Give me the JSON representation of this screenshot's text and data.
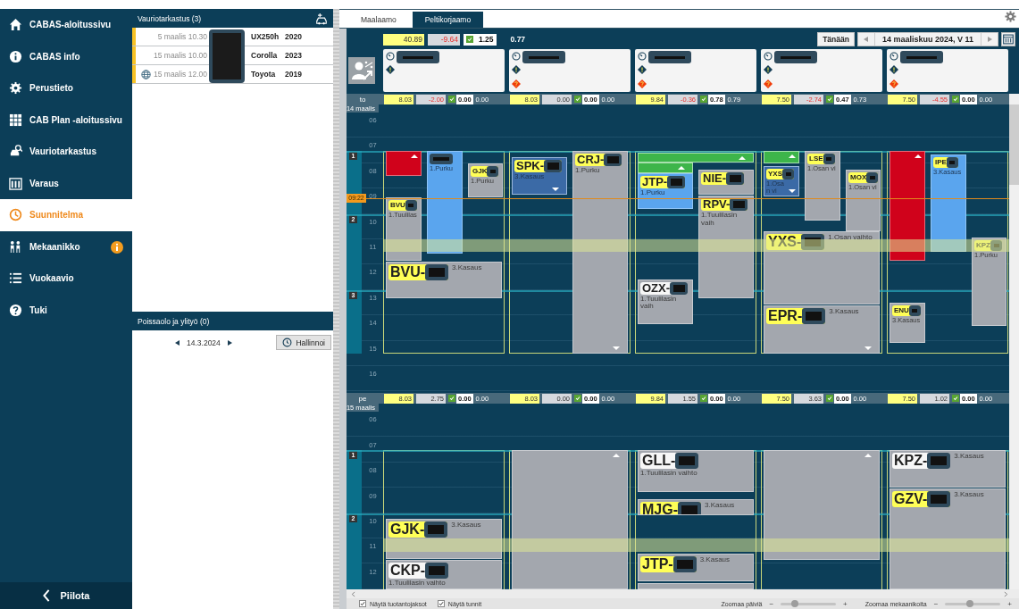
{
  "sidebar": {
    "items": [
      {
        "label": "CABAS-aloitussivu",
        "selected": false,
        "badge": false
      },
      {
        "label": "CABAS info",
        "selected": false,
        "badge": false
      },
      {
        "label": "Perustieto",
        "selected": false,
        "badge": false
      },
      {
        "label": "CAB Plan -aloitussivu",
        "selected": false,
        "badge": false
      },
      {
        "label": "Vauriotarkastus",
        "selected": false,
        "badge": false
      },
      {
        "label": "Varaus",
        "selected": false,
        "badge": false
      },
      {
        "label": "Suunnitelma",
        "selected": true,
        "badge": false
      },
      {
        "label": "Mekaanikko",
        "selected": false,
        "badge": true
      },
      {
        "label": "Vuokaavio",
        "selected": false,
        "badge": false
      },
      {
        "label": "Tuki",
        "selected": false,
        "badge": false
      }
    ],
    "hide_button": "Piilota"
  },
  "inspections": {
    "title": "Vauriotarkastus (3)",
    "rows": [
      {
        "date": "5 maalis 10.30",
        "model": "UX250h",
        "year": "2020",
        "online": false
      },
      {
        "date": "15 maalis 10.00",
        "model": "Corolla",
        "year": "2023",
        "online": false
      },
      {
        "date": "15 maalis 12.00",
        "model": "Toyota",
        "year": "2019",
        "online": true
      }
    ]
  },
  "absences": {
    "title": "Poissaolo ja ylityö (0)",
    "date": "14.3.2024",
    "manage_button": "Hallinnoi"
  },
  "tabs": [
    {
      "label": "Maalaamo",
      "selected": false
    },
    {
      "label": "Peltikorjaamo",
      "selected": true
    }
  ],
  "header": {
    "totals": {
      "hours": "40.89",
      "difference": "-9.64",
      "negative": true,
      "checked": true,
      "progress": "1.25",
      "ratio": "0.77"
    },
    "today_button": "Tänään",
    "date": "14 maaliskuu 2024, V 11"
  },
  "mechanics": [
    {
      "question": false
    },
    {
      "question": true
    },
    {
      "question": true
    },
    {
      "question": true
    },
    {
      "question": true
    }
  ],
  "days": [
    {
      "weekday": "to",
      "date": "14 maalis",
      "hours": [
        "06",
        "07",
        "08",
        "09",
        "10",
        "11",
        "12",
        "13",
        "14",
        "15",
        "16"
      ],
      "markers": [
        {
          "label": "1"
        },
        {
          "label": "2"
        },
        {
          "label": "3"
        }
      ],
      "now": {
        "label": "09:22"
      },
      "totals": [
        {
          "hours": "8.03",
          "difference": "-2.00",
          "negative": true,
          "checked": true,
          "progress": "0.00",
          "ratio": "0.00"
        },
        {
          "hours": "8.03",
          "difference": "0.00",
          "negative": false,
          "checked": true,
          "progress": "0.00",
          "ratio": "0.00"
        },
        {
          "hours": "9.84",
          "difference": "-0.36",
          "negative": true,
          "checked": true,
          "progress": "0.78",
          "ratio": "0.79"
        },
        {
          "hours": "7.50",
          "difference": "-2.74",
          "negative": true,
          "checked": true,
          "progress": "0.47",
          "ratio": "0.73"
        },
        {
          "hours": "7.50",
          "difference": "-4.55",
          "negative": true,
          "checked": true,
          "progress": "0.00",
          "ratio": "0.00"
        }
      ],
      "columns": [
        {
          "jobs": [
            {
              "kind": "red",
              "arrow_up": true
            },
            {
              "kind": "blue",
              "redacted": true,
              "task": "1.Purku"
            },
            {
              "kind": "gray",
              "plate": "GJK",
              "highlighted": true,
              "redacted": true,
              "task": "1.Purku"
            },
            {
              "kind": "gray",
              "plate": "BVU",
              "highlighted": true,
              "redacted": true,
              "task": "1.Tuulilas"
            },
            {
              "kind": "gray",
              "plate": "BVU-",
              "highlighted": true,
              "redacted": true,
              "task": "3.Kasaus"
            }
          ]
        },
        {
          "jobs": [
            {
              "kind": "darkblue",
              "plate": "SPK-",
              "highlighted": true,
              "redacted": true,
              "task": "3.Kasaus",
              "arrow_down": true
            },
            {
              "kind": "gray",
              "plate": "CRJ-",
              "highlighted": true,
              "redacted": true,
              "task": "1.Purku",
              "arrow_down": true
            }
          ]
        },
        {
          "jobs": [
            {
              "kind": "green",
              "arrow_up": true
            },
            {
              "kind": "green",
              "arrow_up": true
            },
            {
              "kind": "blue",
              "plate": "JTP-",
              "highlighted": true,
              "redacted": true,
              "task": "1.Purku"
            },
            {
              "kind": "gray",
              "plate": "NIE-",
              "highlighted": true,
              "redacted": true
            },
            {
              "kind": "gray",
              "plate": "RPV-",
              "highlighted": true,
              "redacted": true,
              "task": "1.Tuulilasin vaih"
            },
            {
              "kind": "gray",
              "plate": "OZX-",
              "highlighted": false,
              "redacted": true,
              "task": "1.Tuulilasin vaih"
            }
          ]
        },
        {
          "jobs": [
            {
              "kind": "green",
              "arrow_up": true
            },
            {
              "kind": "darkblue",
              "plate": "YXS",
              "highlighted": true,
              "redacted": true,
              "task": "1.Osan vi",
              "arrow_down": true
            },
            {
              "kind": "gray",
              "plate": "LSE",
              "highlighted": true,
              "redacted": true,
              "task": "1.Osan vi"
            },
            {
              "kind": "gray",
              "plate": "MOX",
              "highlighted": true,
              "redacted": true,
              "task": "1.Osan vi"
            },
            {
              "kind": "gray",
              "plate": "YXS-",
              "highlighted": true,
              "redacted": true,
              "task": "1.Osan vaihto"
            },
            {
              "kind": "gray",
              "plate": "EPR-",
              "highlighted": true,
              "redacted": true,
              "task": "3.Kasaus",
              "arrow_down": true
            }
          ]
        },
        {
          "jobs": [
            {
              "kind": "red",
              "arrow_up": true
            },
            {
              "kind": "blue",
              "plate": "IPE",
              "highlighted": true,
              "redacted": true,
              "task": "3.Kasaus"
            },
            {
              "kind": "gray",
              "plate": "KPZ",
              "highlighted": true,
              "redacted": true,
              "task": "1.Purku"
            },
            {
              "kind": "gray",
              "plate": "ENU",
              "highlighted": true,
              "redacted": true,
              "task": "3.Kasaus"
            }
          ]
        }
      ]
    },
    {
      "weekday": "pe",
      "date": "15 maalis",
      "hours": [
        "06",
        "07",
        "08",
        "09",
        "10",
        "11",
        "12"
      ],
      "markers": [
        {
          "label": "1"
        },
        {
          "label": "2"
        }
      ],
      "totals": [
        {
          "hours": "8.03",
          "difference": "2.75",
          "negative": false,
          "checked": true,
          "progress": "0.00",
          "ratio": "0.00"
        },
        {
          "hours": "8.03",
          "difference": "0.00",
          "negative": false,
          "checked": true,
          "progress": "0.00",
          "ratio": "0.00"
        },
        {
          "hours": "9.84",
          "difference": "1.55",
          "negative": false,
          "checked": true,
          "progress": "0.00",
          "ratio": "0.00"
        },
        {
          "hours": "7.50",
          "difference": "3.63",
          "negative": false,
          "checked": true,
          "progress": "0.00",
          "ratio": "0.00"
        },
        {
          "hours": "7.50",
          "difference": "1.02",
          "negative": false,
          "checked": true,
          "progress": "0.00",
          "ratio": "0.00"
        }
      ],
      "columns": [
        {
          "jobs": [
            {
              "kind": "gray",
              "plate": "GJK-",
              "highlighted": true,
              "redacted": true,
              "task": "3.Kasaus"
            },
            {
              "kind": "gray",
              "plate": "CKP-",
              "highlighted": false,
              "redacted": true,
              "task": "1.Tuulilasin vaihto"
            }
          ]
        },
        {
          "jobs": [
            {
              "kind": "gray",
              "arrow_up": true
            }
          ]
        },
        {
          "jobs": [
            {
              "kind": "gray",
              "plate": "GLL-",
              "highlighted": false,
              "redacted": true,
              "task": "1.Tuulilasin vaihto"
            },
            {
              "kind": "gray",
              "plate": "MJG-",
              "highlighted": true,
              "redacted": true,
              "task": "3.Kasaus"
            },
            {
              "kind": "gray",
              "plate": "JTP-",
              "highlighted": true,
              "redacted": true,
              "task": "3.Kasaus"
            },
            {
              "kind": "gray"
            }
          ]
        },
        {
          "jobs": [
            {
              "kind": "gray",
              "arrow_up": true
            }
          ]
        },
        {
          "jobs": [
            {
              "kind": "gray",
              "plate": "KPZ-",
              "highlighted": false,
              "redacted": true,
              "task": "3.Kasaus"
            },
            {
              "kind": "gray",
              "plate": "GZV-",
              "highlighted": true,
              "redacted": true,
              "task": "3.Kasaus"
            }
          ]
        }
      ]
    }
  ],
  "footer": {
    "options": [
      {
        "label": "Näytä tuotantojaksot",
        "checked": true
      },
      {
        "label": "Näytä tunnit",
        "checked": true
      }
    ],
    "zooms": [
      {
        "label": "Zoomaa päiviä",
        "minus": "−",
        "plus": "+",
        "level": 0.25
      },
      {
        "label": "Zoomaa mekaanikoita",
        "minus": "−",
        "plus": "+",
        "level": 0.45
      }
    ]
  }
}
